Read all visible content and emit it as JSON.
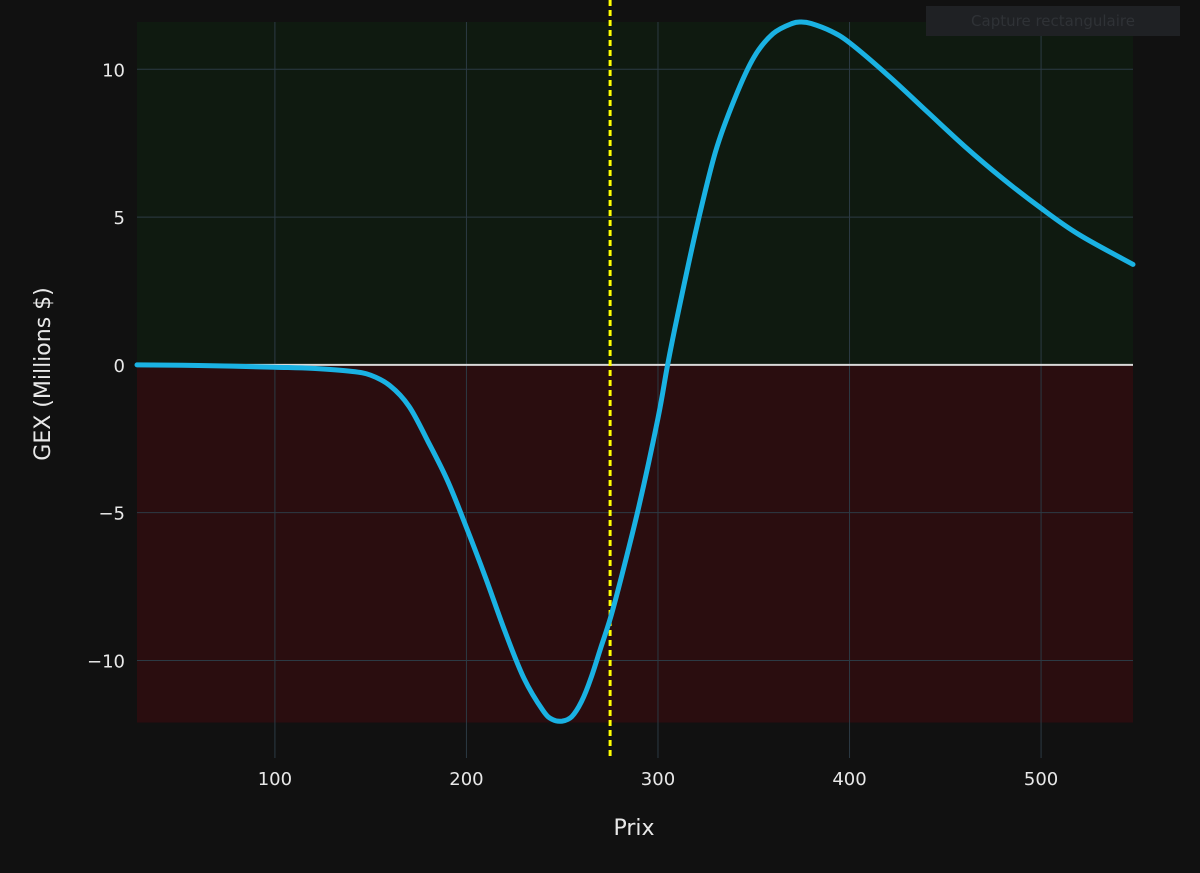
{
  "toolbar": {
    "capture_label": "Capture rectangulaire"
  },
  "colors": {
    "background": "#111111",
    "plot_background": "#111111",
    "positive_zone": "#0f1a10",
    "negative_zone": "#2a0d0f",
    "grid": "#2c3a44",
    "zero_line": "#d8d8d8",
    "curve": "#1ab2e3",
    "spot_line": "#ffff00"
  },
  "chart_data": {
    "type": "line",
    "xlabel": "Prix",
    "ylabel": "GEX (Millions $)",
    "xlim": [
      28,
      548
    ],
    "ylim": [
      -13.3,
      11.6
    ],
    "x_ticks": [
      100,
      200,
      300,
      400,
      500
    ],
    "x_tick_labels": [
      "100",
      "200",
      "300",
      "400",
      "500"
    ],
    "y_ticks": [
      -10,
      -5,
      0,
      5,
      10
    ],
    "y_tick_labels": [
      "−10",
      "−5",
      "0",
      "5",
      "10"
    ],
    "grid": true,
    "zones": [
      {
        "name": "positive",
        "y_from": 0,
        "y_to": 11.6
      },
      {
        "name": "negative",
        "y_from": -12.1,
        "y_to": 0
      }
    ],
    "spot_price": 275,
    "series": [
      {
        "x": [
          28,
          60,
          100,
          120,
          140,
          150,
          160,
          170,
          180,
          190,
          200,
          210,
          220,
          230,
          240,
          245,
          250,
          255,
          260,
          265,
          270,
          275,
          280,
          290,
          300,
          305,
          310,
          320,
          330,
          340,
          350,
          360,
          370,
          375,
          380,
          390,
          400,
          420,
          440,
          460,
          480,
          500,
          520,
          548
        ],
        "y": [
          0,
          -0.02,
          -0.08,
          -0.12,
          -0.22,
          -0.35,
          -0.7,
          -1.4,
          -2.6,
          -3.9,
          -5.5,
          -7.2,
          -9.0,
          -10.6,
          -11.7,
          -12.0,
          -12.05,
          -11.9,
          -11.4,
          -10.6,
          -9.6,
          -8.6,
          -7.4,
          -4.8,
          -1.8,
          0,
          1.6,
          4.6,
          7.2,
          9.0,
          10.4,
          11.2,
          11.55,
          11.6,
          11.55,
          11.3,
          10.9,
          9.8,
          8.6,
          7.4,
          6.3,
          5.3,
          4.4,
          3.4
        ]
      }
    ]
  }
}
